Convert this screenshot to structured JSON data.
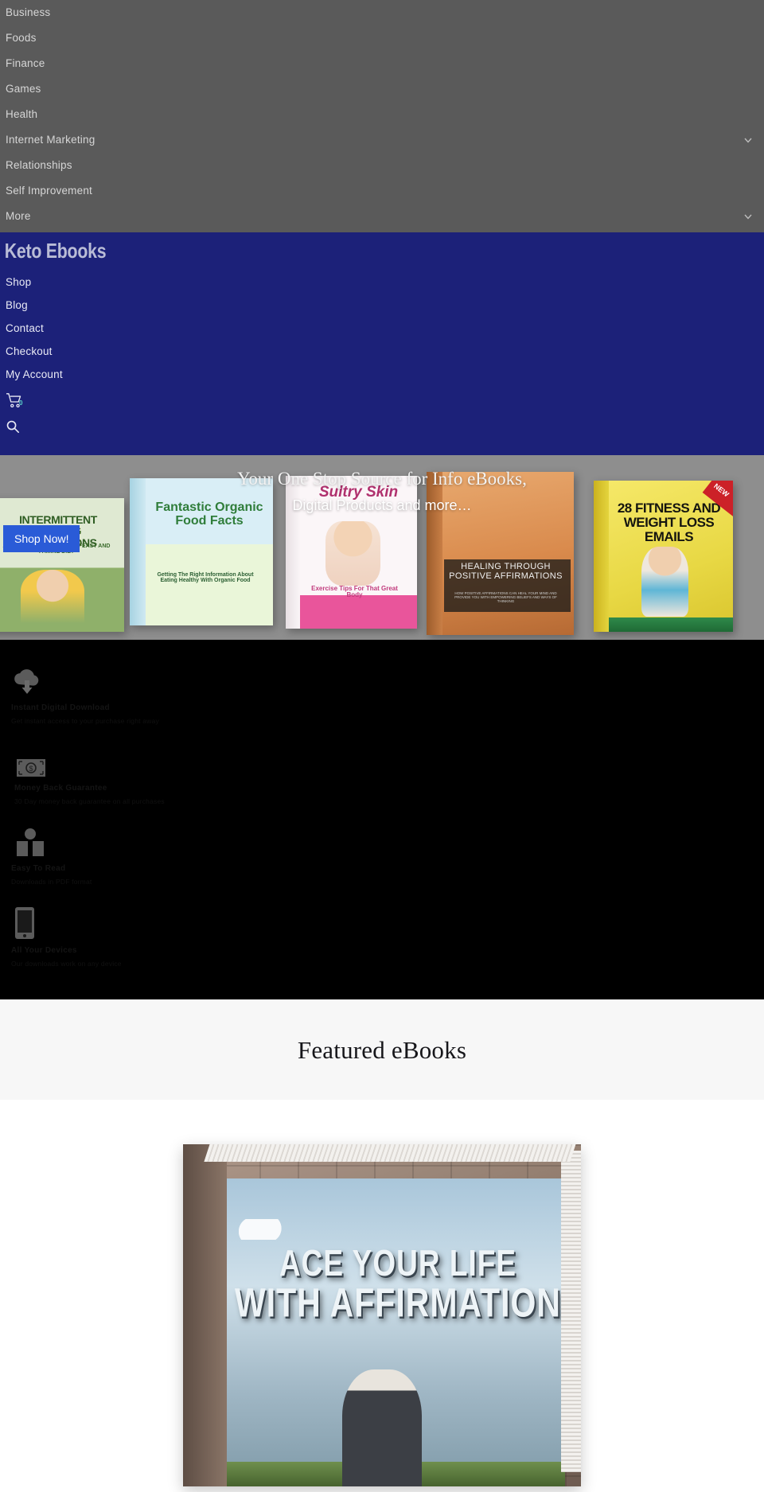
{
  "top_menu": {
    "items": [
      {
        "label": "Business",
        "has_chevron": false
      },
      {
        "label": "Foods",
        "has_chevron": false
      },
      {
        "label": "Finance",
        "has_chevron": false
      },
      {
        "label": "Games",
        "has_chevron": false
      },
      {
        "label": "Health",
        "has_chevron": false
      },
      {
        "label": "Internet Marketing",
        "has_chevron": true
      },
      {
        "label": "Relationships",
        "has_chevron": false
      },
      {
        "label": "Self Improvement",
        "has_chevron": false
      },
      {
        "label": "More",
        "has_chevron": true
      }
    ],
    "background_color": "#5a5a5a",
    "text_color": "#d6d6d6"
  },
  "header": {
    "brand": "Keto Ebooks",
    "background_color": "#1c2179",
    "nav": [
      {
        "label": "Shop"
      },
      {
        "label": "Blog"
      },
      {
        "label": "Contact"
      },
      {
        "label": "Checkout"
      },
      {
        "label": "My Account"
      }
    ],
    "cart": {
      "icon": "shopping-cart-icon",
      "count": "0",
      "count_color": "#59d0c9"
    },
    "search": {
      "icon": "search-icon"
    }
  },
  "hero": {
    "headline_line1": "Your One Stop Source for Info eBooks,",
    "headline_line2": "Digital Products and more…",
    "cta_label": "Shop Now!",
    "cta_color": "#2a5bd7",
    "books": [
      {
        "title": "INTERMITTENT FASTING FOUNDATIONS",
        "subtitle": "AN INTRODUCTION TO THE FEAST AND FAMINE DIET"
      },
      {
        "title": "Fantastic Organic Food Facts",
        "subtitle": "Getting The Right Information About Eating Healthy With Organic Food"
      },
      {
        "title": "Sultry Skin",
        "subtitle": "Exercise Tips For That Great Body"
      },
      {
        "title": "HEALING THROUGH POSITIVE AFFIRMATIONS",
        "subtitle": "HOW POSITIVE AFFIRMATIONS CAN HEAL YOUR MIND AND PROVIDE YOU WITH EMPOWERING BELIEFS AND WAYS OF THINKING"
      },
      {
        "title": "28 FITNESS AND WEIGHT LOSS EMAILS",
        "badge": "NEW"
      }
    ]
  },
  "features": {
    "background_color": "#000000",
    "items": [
      {
        "icon": "cloud-download-icon",
        "title": "Instant Digital Download",
        "desc": "Get instant access to your purchase right away"
      },
      {
        "icon": "money-icon",
        "title": "Money Back Guarantee",
        "desc": "30 Day money back guarantee on all purchases"
      },
      {
        "icon": "open-book-icon",
        "title": "Easy To Read",
        "desc": "Downloads in PDF format"
      },
      {
        "icon": "mobile-phone-icon",
        "title": "All Your Devices",
        "desc": "Our downloads work on any device"
      }
    ]
  },
  "featured": {
    "title": "Featured eBooks",
    "background_color": "#f7f7f7",
    "products": [
      {
        "cover_line1": "ACE YOUR LIFE",
        "cover_line2": "WITH AFFIRMATION"
      }
    ]
  }
}
